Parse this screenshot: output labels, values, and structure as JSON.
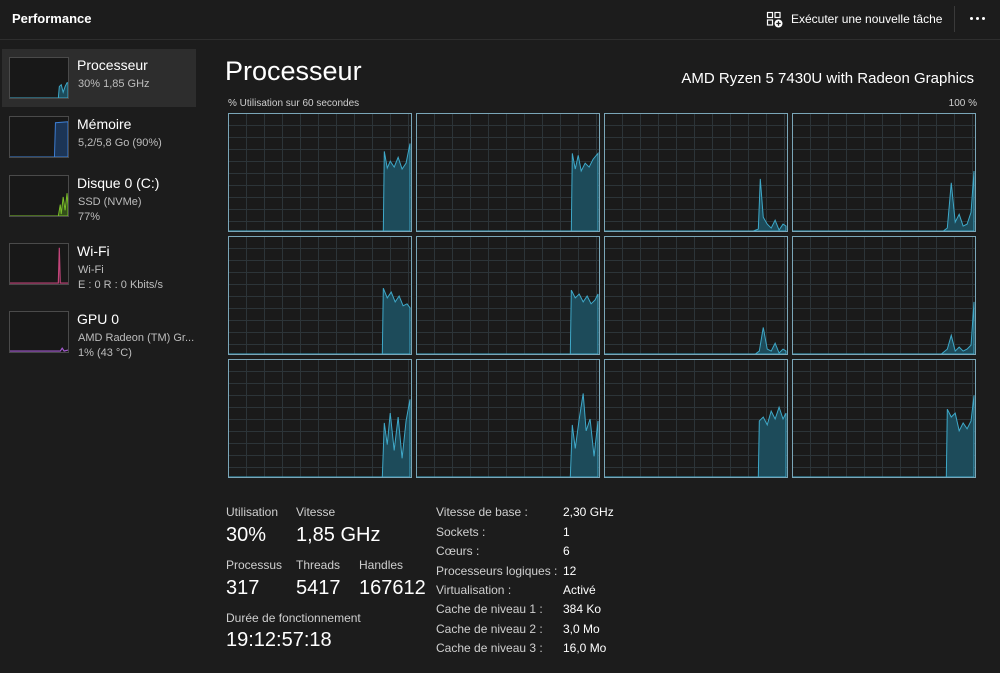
{
  "header": {
    "title": "Performance",
    "run_task_label": "Exécuter une nouvelle tâche",
    "run_task_icon": "run-task-icon",
    "more_icon": "more-options-icon"
  },
  "colors": {
    "background": "#1c1c1c",
    "sidebar_active": "#2d2d2d",
    "cpu_line": "#3fa9c9",
    "memory_line": "#3d7fd6",
    "disk_line": "#7cbf2a",
    "wifi_line": "#c2457a",
    "gpu_line": "#a55bd1"
  },
  "sidebar": {
    "items": [
      {
        "title": "Processeur",
        "line1": "30%  1,85 GHz",
        "line2": "",
        "selected": true
      },
      {
        "title": "Mémoire",
        "line1": "5,2/5,8 Go (90%)",
        "line2": "",
        "selected": false
      },
      {
        "title": "Disque 0 (C:)",
        "line1": "SSD (NVMe)",
        "line2": "77%",
        "selected": false
      },
      {
        "title": "Wi-Fi",
        "line1": "Wi-Fi",
        "line2": "E : 0 R : 0 Kbits/s",
        "selected": false
      },
      {
        "title": "GPU 0",
        "line1": "AMD Radeon (TM) Gr...",
        "line2": "1%  (43 °C)",
        "selected": false
      }
    ]
  },
  "main": {
    "title": "Processeur",
    "cpu_model": "AMD Ryzen 5 7430U with Radeon Graphics",
    "util_label": "% Utilisation sur 60 secondes",
    "util_max": "100 %",
    "logical_processor_graphs": 12
  },
  "stats": {
    "utilisation_label": "Utilisation",
    "utilisation_value": "30%",
    "speed_label": "Vitesse",
    "speed_value": "1,85 GHz",
    "processes_label": "Processus",
    "processes_value": "317",
    "threads_label": "Threads",
    "threads_value": "5417",
    "handles_label": "Handles",
    "handles_value": "167612",
    "uptime_label": "Durée de fonctionnement",
    "uptime_value": "19:12:57:18"
  },
  "specs": [
    {
      "key": "Vitesse de base :",
      "value": "2,30 GHz"
    },
    {
      "key": "Sockets :",
      "value": "1"
    },
    {
      "key": "Cœurs :",
      "value": "6"
    },
    {
      "key": "Processeurs logiques :",
      "value": "12"
    },
    {
      "key": "Virtualisation :",
      "value": "Activé"
    },
    {
      "key": "Cache de niveau 1 :",
      "value": "384 Ko"
    },
    {
      "key": "Cache de niveau 2 :",
      "value": "3,0 Mo"
    },
    {
      "key": "Cache de niveau 3 :",
      "value": "16,0 Mo"
    }
  ]
}
